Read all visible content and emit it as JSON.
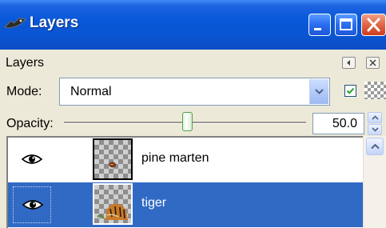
{
  "window": {
    "title": "Layers",
    "title_icon": "gimp-wilber-icon",
    "controls": [
      "minimize-icon",
      "maximize-icon",
      "close-icon"
    ]
  },
  "dock": {
    "label": "Layers",
    "menu_icon": "dock-menu-icon",
    "close_icon": "dock-close-icon"
  },
  "mode": {
    "label": "Mode:",
    "value": "Normal",
    "lock_alpha_checked": true
  },
  "opacity": {
    "label": "Opacity:",
    "value": "50.0",
    "slider_fraction": 0.5
  },
  "layers": [
    {
      "name": "pine marten",
      "visible": true,
      "selected": false
    },
    {
      "name": "tiger",
      "visible": true,
      "selected": true
    }
  ],
  "colors": {
    "titlebar": "#0858d8",
    "selection": "#316ac5",
    "window_bg": "#ece9d8",
    "close_button": "#e36a4a"
  }
}
